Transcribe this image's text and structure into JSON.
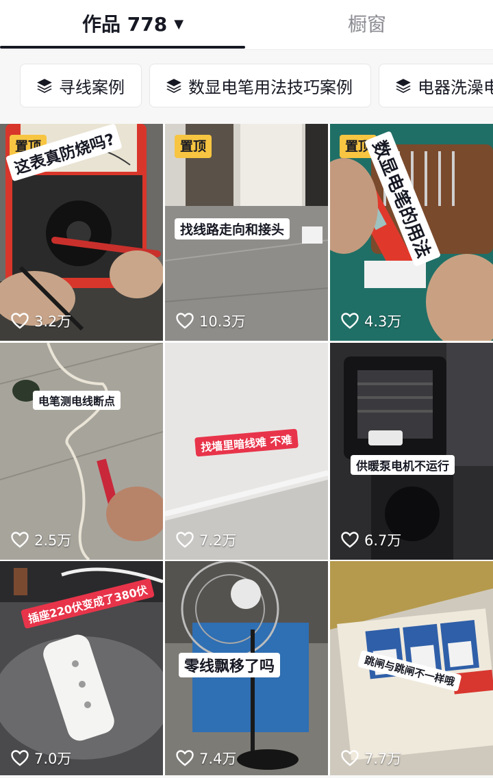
{
  "tabs": {
    "works_label": "作品 778",
    "caret": "▼",
    "shop_label": "橱窗"
  },
  "chips": [
    {
      "label": "寻线案例",
      "icon": "layers-icon"
    },
    {
      "label": "数显电笔用法技巧案例",
      "icon": "layers-icon"
    },
    {
      "label": "电器洗澡电",
      "icon": "layers-icon"
    }
  ],
  "colors": {
    "pin_badge": "#f7c541",
    "red_caption": "#e8344a",
    "active_text": "#161823",
    "inactive_text": "#8a8b91"
  },
  "videos": [
    {
      "pinned": "置顶",
      "caption": "这表真防烧吗?",
      "likes": "3.2万"
    },
    {
      "pinned": "置顶",
      "caption": "找线路走向和接头",
      "likes": "10.3万"
    },
    {
      "pinned": "置顶",
      "caption": "数显电笔的用法",
      "likes": "4.3万"
    },
    {
      "caption": "电笔测电线断点",
      "likes": "2.5万"
    },
    {
      "caption": "找墙里暗线难 不难",
      "likes": "7.2万"
    },
    {
      "caption": "供暖泵电机不运行",
      "likes": "6.7万"
    },
    {
      "caption": "插座220伏变成了380伏",
      "likes": "7.0万"
    },
    {
      "caption": "零线飘移了吗",
      "likes": "7.4万"
    },
    {
      "caption": "跳闸与跳闸不一样哦",
      "likes": "7.7万"
    }
  ]
}
